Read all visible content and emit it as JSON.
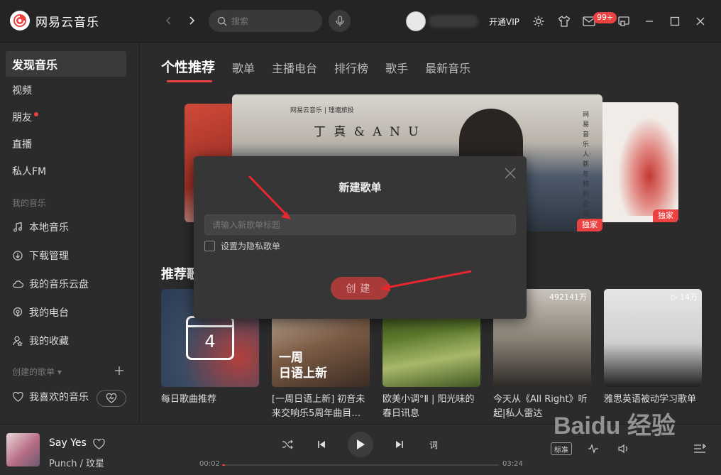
{
  "app": {
    "logo_text": "网易云音乐"
  },
  "header": {
    "search_placeholder": "搜索",
    "vip_label": "开通VIP",
    "message_badge": "99+"
  },
  "sidebar": {
    "items": [
      {
        "label": "发现音乐"
      },
      {
        "label": "视频"
      },
      {
        "label": "朋友"
      },
      {
        "label": "直播"
      },
      {
        "label": "私人FM"
      }
    ],
    "my_music_title": "我的音乐",
    "my_music": [
      {
        "label": "本地音乐"
      },
      {
        "label": "下载管理"
      },
      {
        "label": "我的音乐云盘"
      },
      {
        "label": "我的电台"
      },
      {
        "label": "我的收藏"
      }
    ],
    "created_title": "创建的歌单",
    "liked_label": "我喜欢的音乐"
  },
  "tabs": [
    {
      "label": "个性推荐"
    },
    {
      "label": "歌单"
    },
    {
      "label": "主播电台"
    },
    {
      "label": "排行榜"
    },
    {
      "label": "歌手"
    },
    {
      "label": "最新音乐"
    }
  ],
  "banner": {
    "top_line": "网易云音乐 | 理塘旅投",
    "title": "丁 真 & A N U",
    "vertical_text": "网易音乐人·新年特别企划",
    "exclusive_label": "独家",
    "right_exclusive_label": "独家"
  },
  "recommend": {
    "section_title": "推荐歌单",
    "cards": [
      {
        "caption": "每日歌曲推荐",
        "calendar_day": "4",
        "play_count": ""
      },
      {
        "caption": "[一周日语上新] 初音未来交响乐5周年曲目…",
        "cover_text_1": "一周",
        "cover_text_2": "日语上新",
        "play_count": ""
      },
      {
        "caption": "欧美小调°Ⅱ | 阳光味的春日讯息",
        "play_count": ""
      },
      {
        "caption": "今天从《All Right》听起|私人雷达",
        "play_count": "492141万"
      },
      {
        "caption": "雅思英语被动学习歌单",
        "play_count": "14万"
      }
    ]
  },
  "modal": {
    "title": "新建歌单",
    "input_placeholder": "请输入新歌单标题",
    "privacy_label": "设置为隐私歌单",
    "create_label": "创建"
  },
  "player": {
    "song": "Say Yes",
    "artist": "Punch / 玟星",
    "current_time": "00:02",
    "total_time": "03:24",
    "progress": 0.01,
    "lyric_label": "词",
    "sound_quality": "标准"
  },
  "watermark": {
    "text": "Baidu 经验"
  },
  "colors": {
    "accent": "#ec4141",
    "background": "#2b2b2b",
    "arrow": "#e8262e"
  }
}
